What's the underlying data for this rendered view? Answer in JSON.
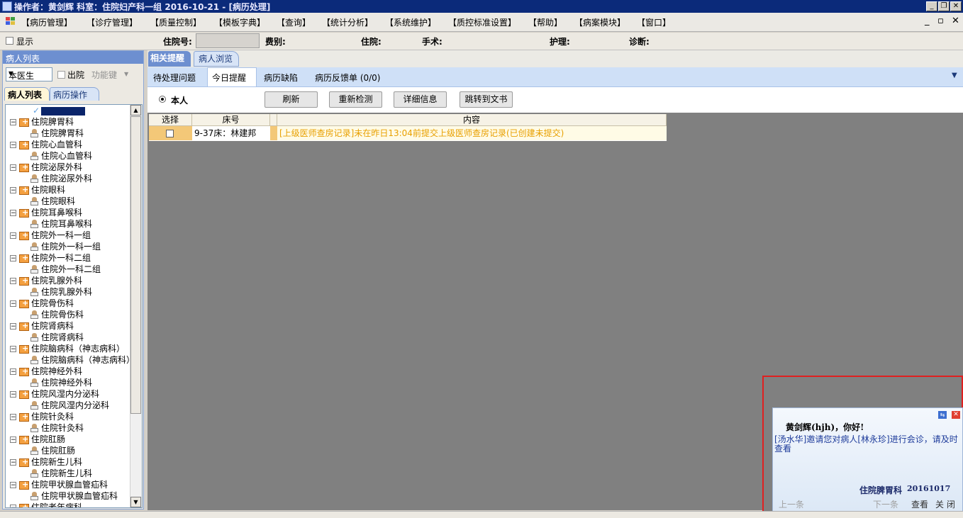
{
  "title_bar": {
    "text": "操作者：黄剑辉  科室：住院妇产科一组  2016-10-21 - [病历处理]"
  },
  "menu": [
    "【病历管理】",
    "【诊疗管理】",
    "【质量控制】",
    "【模板字典】",
    "【查询】",
    "【统计分析】",
    "【系统维护】",
    "【质控标准设置】",
    "【帮助】",
    "【病案模块】",
    "【窗口】"
  ],
  "mdi_controls": {
    "minimize": "_",
    "restore": "▫",
    "close": "✕"
  },
  "info_bar": {
    "show_label": "显示",
    "inpatient_no_label": "住院号:",
    "fee_label": "费别:",
    "inpatient_label": "住院:",
    "surgery_label": "手术:",
    "nursing_label": "护理:",
    "diagnosis_label": "诊断:"
  },
  "left_panel": {
    "header": "病人列表",
    "pin": "ᵖ",
    "doctor_select": "本医生",
    "discharge_label": "出院",
    "function_key_label": "功能键",
    "tabs": [
      "病人列表",
      "病历操作"
    ],
    "tree": [
      {
        "dept": "住院脾胃科",
        "child": "住院脾胃科"
      },
      {
        "dept": "住院心血管科",
        "child": "住院心血管科"
      },
      {
        "dept": "住院泌尿外科",
        "child": "住院泌尿外科"
      },
      {
        "dept": "住院眼科",
        "child": "住院眼科"
      },
      {
        "dept": "住院耳鼻喉科",
        "child": "住院耳鼻喉科"
      },
      {
        "dept": "住院外一科一组",
        "child": "住院外一科一组"
      },
      {
        "dept": "住院外一科二组",
        "child": "住院外一科二组"
      },
      {
        "dept": "住院乳腺外科",
        "child": "住院乳腺外科"
      },
      {
        "dept": "住院骨伤科",
        "child": "住院骨伤科"
      },
      {
        "dept": "住院肾病科",
        "child": "住院肾病科"
      },
      {
        "dept": "住院脑病科（神志病科）",
        "child": "住院脑病科（神志病科）"
      },
      {
        "dept": "住院神经外科",
        "child": "住院神经外科"
      },
      {
        "dept": "住院风湿内分泌科",
        "child": "住院风湿内分泌科"
      },
      {
        "dept": "住院针灸科",
        "child": "住院针灸科"
      },
      {
        "dept": "住院肛肠",
        "child": "住院肛肠"
      },
      {
        "dept": "住院新生儿科",
        "child": "住院新生儿科"
      },
      {
        "dept": "住院甲状腺血管疝科",
        "child": "住院甲状腺血管疝科"
      },
      {
        "dept": "住院老年病科",
        "child": ""
      }
    ]
  },
  "main_tabs": [
    "相关提醒",
    "病人浏览"
  ],
  "sub_tabs": [
    "待处理问题",
    "今日提醒",
    "病历缺陷",
    "病历反馈单 (0/0)"
  ],
  "radio_label": "本人",
  "toolbar_buttons": [
    "刷新",
    "重新检测",
    "详细信息",
    "跳转到文书"
  ],
  "grid": {
    "headers": [
      "选择",
      "床号",
      "内容"
    ],
    "rows": [
      {
        "bed": "9-37床：林建邦",
        "content": "[上级医师查房记录]未在昨日13:04前提交上级医师查房记录(已创建未提交)"
      }
    ]
  },
  "popup": {
    "greeting": "黄剑辉(hjh)，你好!",
    "message": "[汤水华]邀请您对病人[林永珍]进行会诊，请及时查看",
    "dept": "住院脾胃科",
    "date": "20161017",
    "prev": "上一条",
    "next": "下一条",
    "view": "查看",
    "close": "关 闭"
  },
  "colors": {
    "accent": "#6d8fd0",
    "warning_text": "#e8a000",
    "row_bg": "#fffbe6",
    "alert_border": "#e02020"
  }
}
